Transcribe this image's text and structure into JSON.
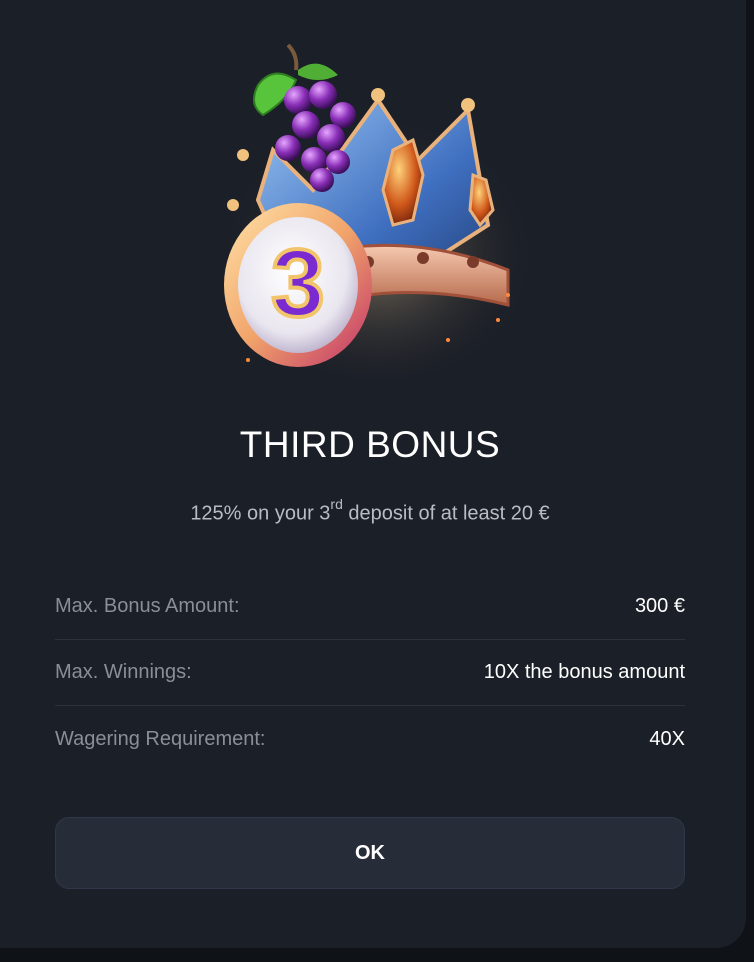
{
  "bonus": {
    "title": "THIRD BONUS",
    "subtitle_pre": "125% on your 3",
    "subtitle_sup": "rd",
    "subtitle_post": " deposit of at least 20 €",
    "badge_number": "3"
  },
  "details": [
    {
      "label": "Max. Bonus Amount:",
      "value": "300 €"
    },
    {
      "label": "Max. Winnings:",
      "value": "10X the bonus amount"
    },
    {
      "label": "Wagering Requirement:",
      "value": "40X"
    }
  ],
  "actions": {
    "ok_label": "OK"
  },
  "colors": {
    "background": "#1b1f27",
    "button": "#272c39",
    "crown": "#5d8fd8",
    "badge": "#7a2ad0",
    "grapes": "#7b2a9e"
  },
  "icons": {
    "illustration": "crown-grapes-badge-3-icon"
  }
}
